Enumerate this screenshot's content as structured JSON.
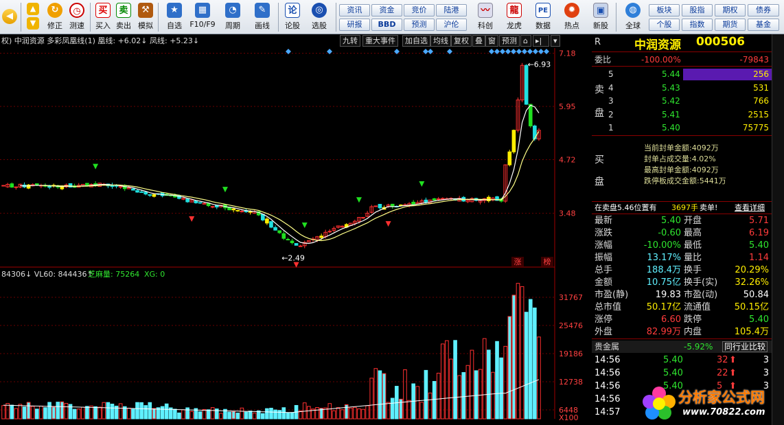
{
  "toolbar": {
    "buttons": [
      {
        "label": "修正",
        "icon": "up-arrow-icon"
      },
      {
        "label": "测速",
        "icon": "clock-icon"
      },
      {
        "label": "买入",
        "icon": "buy-icon",
        "glyph": "买"
      },
      {
        "label": "卖出",
        "icon": "sell-icon",
        "glyph": "卖"
      },
      {
        "label": "模拟",
        "icon": "gavel-icon"
      },
      {
        "label": "自选",
        "icon": "star-icon"
      },
      {
        "label": "F10/F9",
        "icon": "f10-icon"
      },
      {
        "label": "周期",
        "icon": "period-icon"
      },
      {
        "label": "画线",
        "icon": "pencil-icon"
      },
      {
        "label": "论股",
        "icon": "discuss-icon",
        "glyph": "论"
      },
      {
        "label": "选股",
        "icon": "select-stock-icon"
      },
      {
        "label": "科创",
        "icon": "tech-chart-icon"
      },
      {
        "label": "龙虎",
        "icon": "dragon-tiger-icon"
      },
      {
        "label": "数据",
        "icon": "pe-icon",
        "glyph": "PE"
      },
      {
        "label": "热点",
        "icon": "hot-icon"
      },
      {
        "label": "新股",
        "icon": "new-stock-icon"
      },
      {
        "label": "全球",
        "icon": "globe-icon"
      }
    ],
    "small_buttons": [
      "资讯",
      "资金",
      "竞价",
      "陆港",
      "研报",
      "BBD",
      "预测",
      "沪伦"
    ],
    "right_buttons": [
      "板块",
      "股指",
      "期权",
      "债券",
      "个股",
      "指数",
      "期货",
      "基金"
    ]
  },
  "chartbar": {
    "title": "权) 中润资源 多彩凤凰线(1) 凰线: +6.02↓ 凤线: +5.23↓",
    "buttons": [
      "九转",
      "重大事件",
      "加自选",
      "均线",
      "复权",
      "叠",
      "窗",
      "预测"
    ]
  },
  "price_axis": [
    "7.18",
    "5.95",
    "4.72",
    "3.48"
  ],
  "high_label": "6.93",
  "low_label": "2.49",
  "tags": [
    "涨",
    "榜"
  ],
  "volbar": {
    "text1": "84306↓ VL60: 844436↑",
    "text2": "芝麻量: 75264",
    "text3": "XG: 0"
  },
  "vol_axis": [
    "31767",
    "25476",
    "19186",
    "12738",
    "6448",
    "X100"
  ],
  "quote": {
    "header": {
      "r": "R",
      "name": "中润资源",
      "code": "000506"
    },
    "weibi": {
      "label": "委比",
      "pct": "-100.00%",
      "diff": "-79843"
    },
    "sell": [
      {
        "n": "5",
        "p": "5.44",
        "v": "256"
      },
      {
        "n": "4",
        "p": "5.43",
        "v": "531"
      },
      {
        "n": "3",
        "p": "5.42",
        "v": "766"
      },
      {
        "n": "2",
        "p": "5.41",
        "v": "2515"
      },
      {
        "n": "1",
        "p": "5.40",
        "v": "75775"
      }
    ],
    "sell_side": [
      "卖",
      "盘"
    ],
    "buy_side": [
      "买",
      "盘"
    ],
    "limit_info": [
      "当前封单金额:4092万",
      "封单占成交量:4.02%",
      "最高封单金额:4092万",
      "跌停板成交金额:5441万"
    ],
    "ticker": {
      "text": "在卖盘5.46位置有",
      "vol": "3697手",
      "tail": "卖单!",
      "detail": "查看详细"
    },
    "stats": [
      [
        "最新",
        "5.40",
        "开盘",
        "5.71"
      ],
      [
        "涨跌",
        "-0.60",
        "最高",
        "6.19"
      ],
      [
        "涨幅",
        "-10.00%",
        "最低",
        "5.40"
      ],
      [
        "振幅",
        "13.17%",
        "量比",
        "1.14"
      ],
      [
        "总手",
        "188.4万",
        "换手",
        "20.29%"
      ],
      [
        "金额",
        "10.75亿",
        "换手(实)",
        "32.26%"
      ],
      [
        "市盈(静)",
        "19.83",
        "市盈(动)",
        "50.84"
      ],
      [
        "总市值",
        "50.17亿",
        "流通值",
        "50.15亿"
      ],
      [
        "涨停",
        "6.60",
        "跌停",
        "5.40"
      ],
      [
        "外盘",
        "82.99万",
        "内盘",
        "105.4万"
      ]
    ],
    "sector": {
      "name": "贵金属",
      "pct": "-5.92%",
      "compare": "同行业比较"
    },
    "ticks": [
      {
        "t": "14:56",
        "p": "5.40",
        "v": "32",
        "k": "3"
      },
      {
        "t": "14:56",
        "p": "5.40",
        "v": "22",
        "k": "3"
      },
      {
        "t": "14:56",
        "p": "5.40",
        "v": "5",
        "k": "3"
      },
      {
        "t": "14:56",
        "p": "",
        "v": "",
        "k": ""
      },
      {
        "t": "14:57",
        "p": "",
        "v": "",
        "k": ""
      }
    ]
  },
  "watermark": {
    "text": "分析家公式网",
    "url": "www.70822.com"
  },
  "chart_data": {
    "type": "candlestick",
    "price_ylim": [
      2.3,
      7.3
    ],
    "volume_ylim": [
      0,
      33000
    ],
    "close_tail": [
      4.6,
      4.9,
      5.4,
      6.1,
      6.9,
      6.0,
      5.5,
      5.2,
      5.4
    ]
  },
  "colors": {
    "up": "#ff3030",
    "down": "#20e0e0",
    "bg": "#000000",
    "grid": "#7a0000"
  }
}
